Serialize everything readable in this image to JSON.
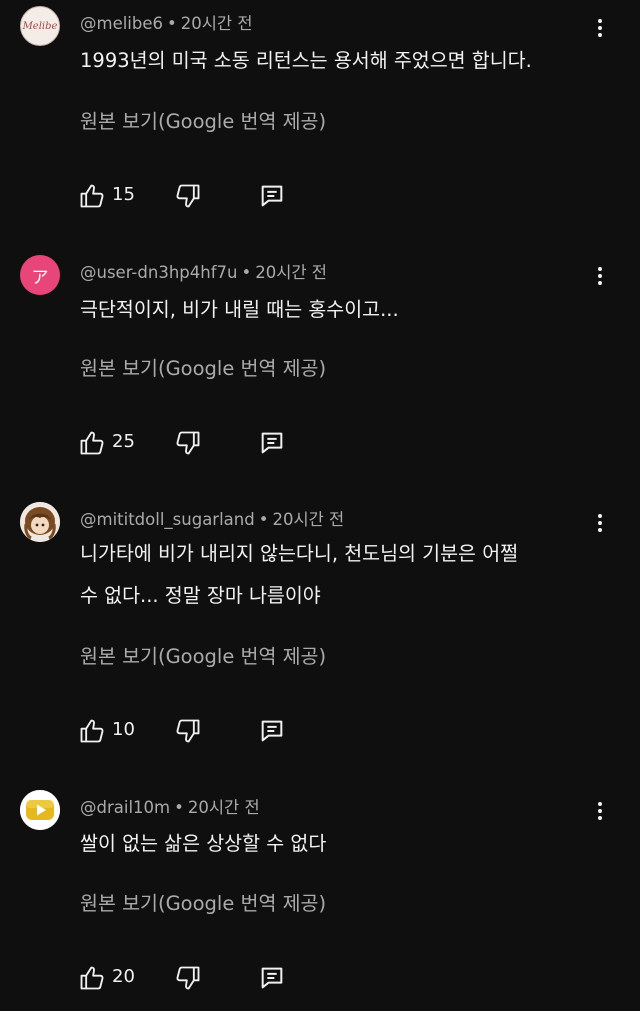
{
  "comments": [
    {
      "author": "@melibe6",
      "time": "20시간 전",
      "avatar_text": "Melibe",
      "text": "1993년의 미국 소동 리턴스는 용서해 주었으면 합니다.",
      "translate_label": "원본 보기(Google 번역 제공)",
      "likes": "15"
    },
    {
      "author": "@user-dn3hp4hf7u",
      "time": "20시간 전",
      "avatar_text": "ア",
      "text": "극단적이지, 비가 내릴 때는 홍수이고...",
      "translate_label": "원본 보기(Google 번역 제공)",
      "likes": "25"
    },
    {
      "author": "@mititdoll_sugarland",
      "time": "20시간 전",
      "text_line1": "니가타에 비가 내리지 않는다니, 천도님의 기분은 어쩔",
      "text_line2": "수 없다... 정말 장마 나름이야",
      "translate_label": "원본 보기(Google 번역 제공)",
      "likes": "10"
    },
    {
      "author": "@drail10m",
      "time": "20시간 전",
      "text": "쌀이 없는 삶은 상상할 수 없다",
      "translate_label": "원본 보기(Google 번역 제공)",
      "likes": "20"
    }
  ],
  "icons": {
    "like": "thumb-up-icon",
    "dislike": "thumb-down-icon",
    "reply": "reply-icon",
    "more": "more-vert-icon"
  },
  "colors": {
    "background": "#0f0f0f",
    "primary_text": "#f1f1f1",
    "secondary_text": "#aaaaaa",
    "avatar_pink": "#e8467a",
    "avatar_gold": "#e5b81c"
  }
}
